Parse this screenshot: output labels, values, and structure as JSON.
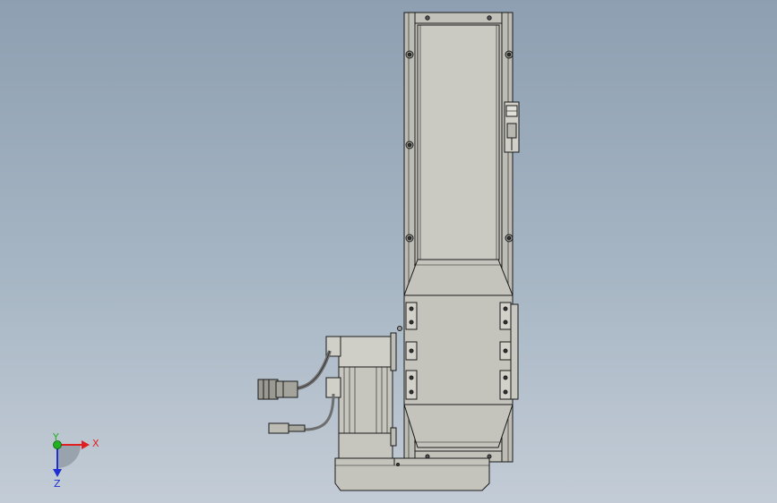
{
  "viewport": {
    "background_top": "#8d9fb1",
    "background_bottom": "#c3ccd6"
  },
  "model": {
    "line_color": "#1a1a1a",
    "body_fill": "#c8c8c0",
    "rail_fill": "#bcbcb4",
    "cable_color": "#6e6e6e"
  },
  "triad": {
    "x_label": "X",
    "y_label": "Y",
    "z_label": "Z",
    "x_color": "#e02020",
    "y_color": "#20b020",
    "z_color": "#2030d0"
  }
}
